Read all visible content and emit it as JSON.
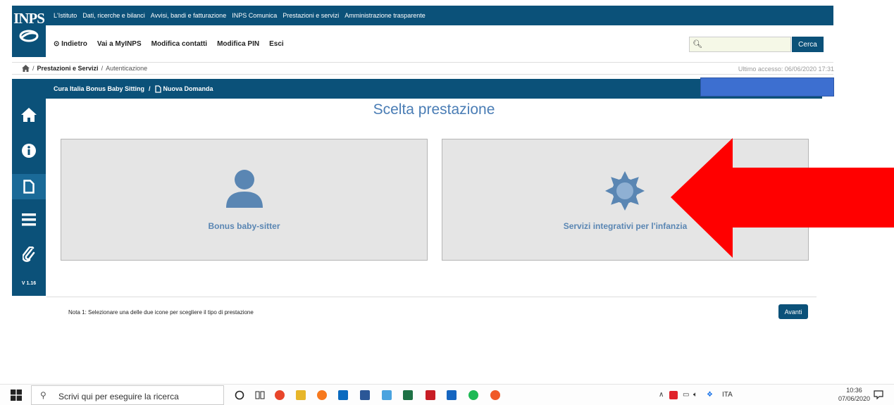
{
  "header": {
    "logo_text": "INPS",
    "top_links": [
      "L'Istituto",
      "Dati, ricerche e bilanci",
      "Avvisi, bandi e fatturazione",
      "INPS Comunica",
      "Prestazioni e servizi",
      "Amministrazione trasparente"
    ],
    "nav": {
      "back": "⊙ Indietro",
      "myinps": "Vai a MyINPS",
      "contatti": "Modifica contatti",
      "pin": "Modifica PIN",
      "esci": "Esci"
    },
    "search": {
      "placeholder": "",
      "button": "Cerca"
    }
  },
  "breadcrumb": {
    "items": [
      "Prestazioni e Servizi",
      "Autenticazione"
    ],
    "sep": "/"
  },
  "last_access": "Ultimo accesso: 06/06/2020 17:31",
  "sidebar": {
    "version": "V 1.16",
    "items": [
      "home-icon",
      "info-icon",
      "document-icon",
      "menu-icon",
      "attachment-icon"
    ]
  },
  "section_header": {
    "path": "Cura Italia Bonus Baby Sitting",
    "sep": "/",
    "current": "Nuova Domanda"
  },
  "main": {
    "title": "Scelta prestazione",
    "cards": [
      {
        "label": "Bonus baby-sitter",
        "icon": "user-icon"
      },
      {
        "label": "Servizi integrativi per l'infanzia",
        "icon": "gear-icon"
      }
    ],
    "note": "Nota 1: Selezionare una delle due icone per scegliere il tipo di prestazione",
    "next_button": "Avanti"
  },
  "annotation_color": "#ff0000",
  "taskbar": {
    "search_placeholder": "Scrivi qui per eseguire la ricerca",
    "lang": "ITA",
    "time": "10:36",
    "date": "07/06/2020"
  }
}
